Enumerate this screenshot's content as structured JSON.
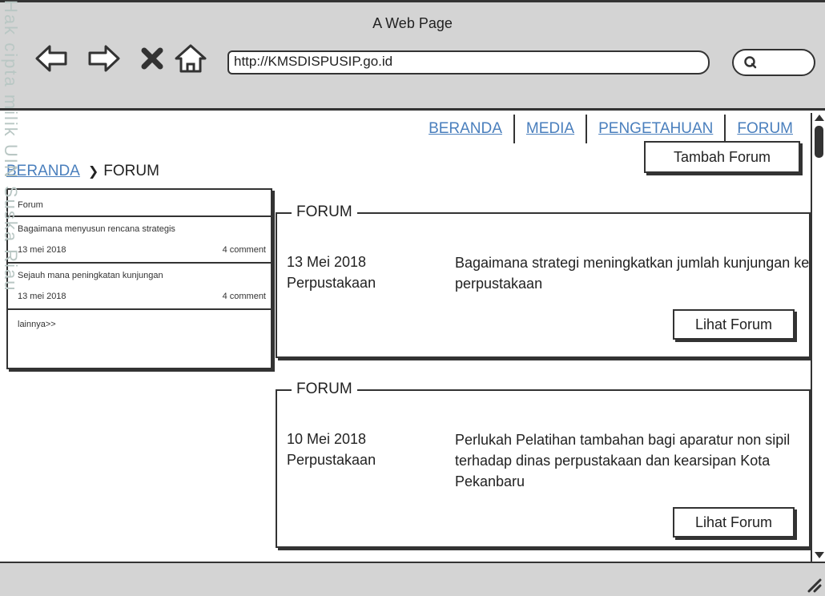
{
  "window": {
    "title": "A Web Page"
  },
  "browser": {
    "url": "http://KMSDISPUSIP.go.id",
    "icons": [
      "back-arrow-icon",
      "forward-arrow-icon",
      "stop-x-icon",
      "home-icon",
      "search-icon"
    ]
  },
  "watermark_text": "Hak cipta milik UIN Suska Riau",
  "topnav": {
    "items": [
      {
        "label": "BERANDA"
      },
      {
        "label": "MEDIA"
      },
      {
        "label": "PENGETAHUAN"
      },
      {
        "label": "FORUM"
      }
    ]
  },
  "add_forum_label": "Tambah Forum",
  "breadcrumb": {
    "home": "BERANDA",
    "current": "FORUM"
  },
  "sidebar": {
    "heading": "Forum",
    "items": [
      {
        "title": "Bagaimana menyusun rencana strategis",
        "date": "13 mei 2018",
        "comments": "4 comment"
      },
      {
        "title": "Sejauh mana peningkatan kunjungan",
        "date": "13 mei 2018",
        "comments": "4 comment"
      }
    ],
    "more": "lainnya>>"
  },
  "forums": [
    {
      "legend": "FORUM",
      "date": "13 Mei 2018",
      "category": "Perpustakaan",
      "text": "Bagaimana strategi meningkatkan jumlah kunjungan ke perpustakaan",
      "button": "Lihat Forum"
    },
    {
      "legend": "FORUM",
      "date": "10 Mei 2018",
      "category": "Perpustakaan",
      "text": "Perlukah Pelatihan tambahan bagi aparatur non sipil terhadap dinas perpustakaan dan kearsipan Kota Pekanbaru",
      "button": "Lihat Forum"
    }
  ]
}
